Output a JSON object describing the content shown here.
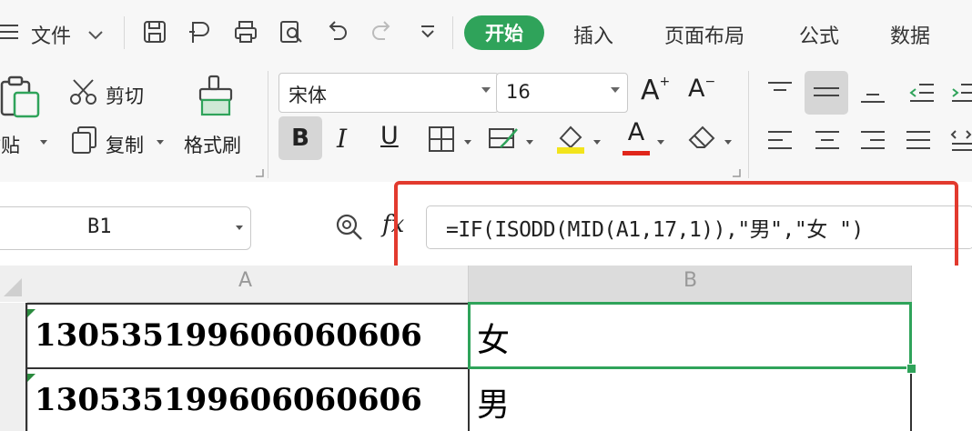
{
  "menubar": {
    "file_label": "文件",
    "tabs": [
      "开始",
      "插入",
      "页面布局",
      "公式",
      "数据"
    ],
    "active_tab": "开始"
  },
  "ribbon": {
    "cut_label": "剪切",
    "paste_label": "粘贴",
    "copy_label": "复制",
    "format_painter_label": "格式刷",
    "font_name": "宋体",
    "font_size": "16",
    "bold_glyph": "B",
    "italic_glyph": "I",
    "underline_glyph": "U",
    "grow_font_glyph": "A",
    "shrink_font_glyph": "A",
    "font_color_glyph": "A",
    "font_color": "#e0261b",
    "fill_color": "#f2e41c"
  },
  "formula_bar": {
    "name_box": "B1",
    "fx_label": "fx",
    "formula": "=IF(ISODD(MID(A1,17,1)),\"男\",\"女 \")"
  },
  "sheet": {
    "columns": [
      "A",
      "B"
    ],
    "rows": [
      {
        "A": "130535199606060606",
        "B": "女"
      },
      {
        "A": "130535199606060606",
        "B": "男"
      }
    ],
    "active_cell": "B1",
    "accent_color": "#2fa35a"
  }
}
